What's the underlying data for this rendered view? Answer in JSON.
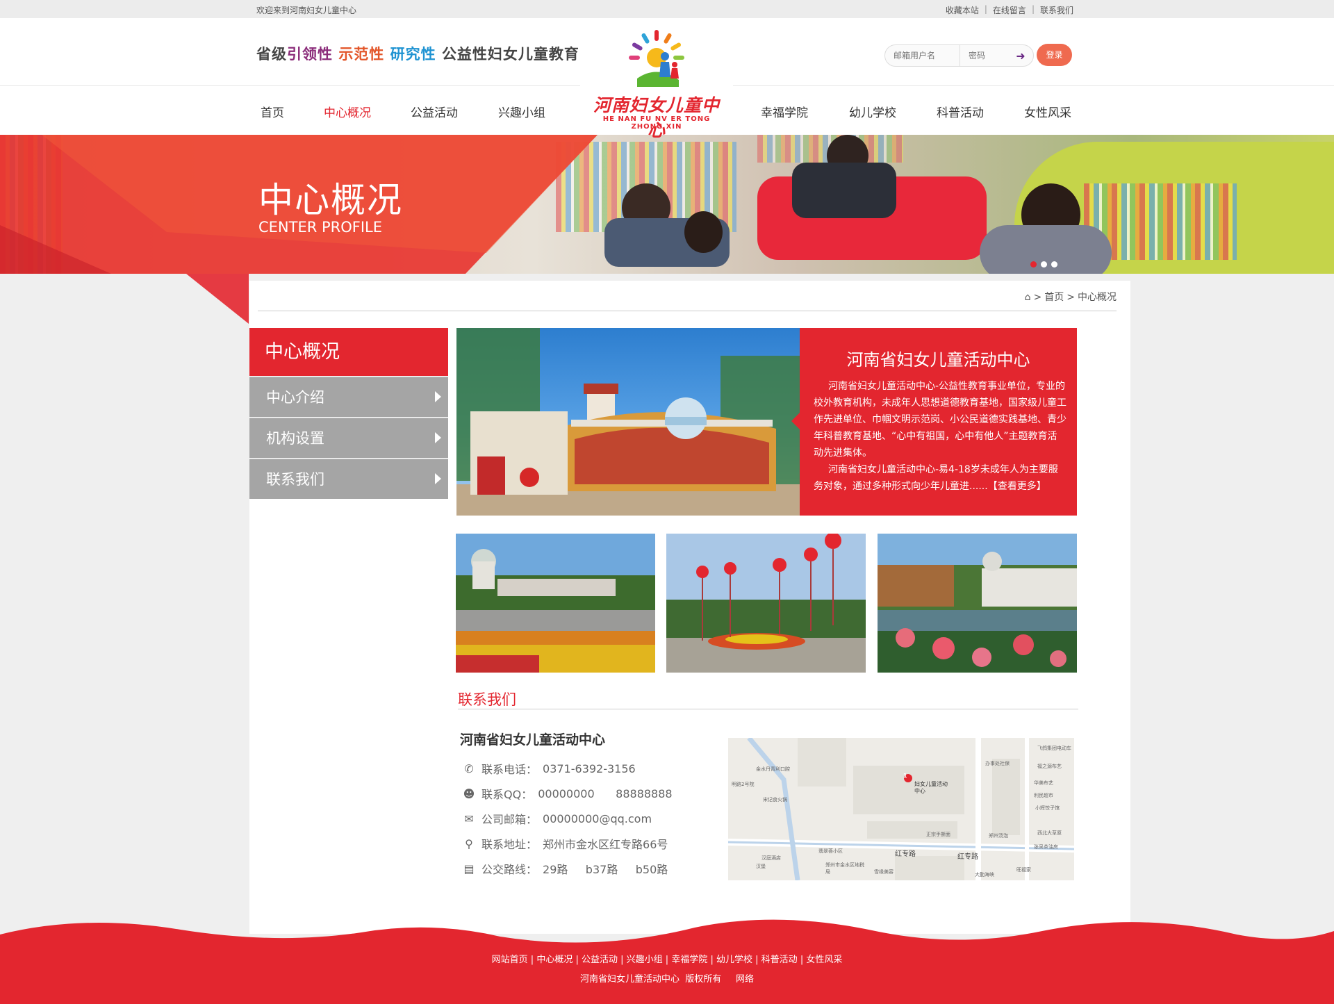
{
  "topbar": {
    "welcome": "欢迎来到河南妇女儿童中心",
    "links": [
      "收藏本站",
      "在线留言",
      "联系我们"
    ]
  },
  "header": {
    "slogan": {
      "p1": "省级",
      "p2": "引领性",
      "p3": "示范性",
      "p4": "研究性",
      "p5": "公益性妇女儿童教育阵地"
    },
    "login": {
      "user_placeholder": "邮箱用户名",
      "pwd_placeholder": "密码",
      "submit_label": "登录",
      "go_icon": "arrow-right-icon"
    },
    "logo": {
      "cn": "河南妇女儿童中心",
      "en": "HE NAN FU NV ER TONG  ZHONG XIN"
    }
  },
  "nav": {
    "items": [
      "首页",
      "中心概况",
      "公益活动",
      "兴趣小组",
      "幸福学院",
      "幼儿学校",
      "科普活动",
      "女性风采"
    ],
    "active": "中心概况"
  },
  "banner": {
    "title_cn": "中心概况",
    "title_en": "CENTER PROFILE"
  },
  "breadcrumb": {
    "home_icon": "home-icon",
    "sep": ">",
    "home": "首页",
    "current": "中心概况"
  },
  "sidebar": {
    "heading": "中心概况",
    "items": [
      "中心介绍",
      "机构设置",
      "联系我们"
    ]
  },
  "intro": {
    "title": "河南省妇女儿童活动中心",
    "para1": "河南省妇女儿童活动中心-公益性教育事业单位，专业的校外教育机构，未成年人思想道德教育基地，国家级儿童工作先进单位、巾帼文明示范岗、小公民道德实践基地、青少年科普教育基地、“心中有祖国，心中有他人”主题教育活动先进集体。",
    "para2": "河南省妇女儿童活动中心-易4-18岁未成年人为主要服务对象，通过多种形式向少年儿童进......",
    "more": "【查看更多】"
  },
  "contact": {
    "title": "联系我们",
    "org": "河南省妇女儿童活动中心",
    "rows": [
      {
        "icon": "phone-icon",
        "label": "联系电话：",
        "value": "0371-6392-3156"
      },
      {
        "icon": "qq-icon",
        "label": "联系QQ：",
        "value": "00000000      88888888"
      },
      {
        "icon": "mail-icon",
        "label": "公司邮箱：",
        "value": "00000000@qq.com"
      },
      {
        "icon": "location-icon",
        "label": "联系地址：",
        "value": "郑州市金水区红专路66号"
      },
      {
        "icon": "bus-icon",
        "label": "公交路线：",
        "value": "29路     b37路     b50路"
      }
    ],
    "map": {
      "marker_label": "妇女儿童活动中心",
      "roads": [
        "红专路",
        "红专路"
      ],
      "pois": [
        "金水丹青利口腔",
        "飞鸽集团电动车",
        "办事处社保",
        "福之源布艺",
        "明路2号院",
        "宋记食火锅",
        "小辉饺子馆",
        "正宗手撕面",
        "郑州汤泡",
        "西北大草原",
        "张吴茶油房",
        "汉庭酒店",
        "翡翠荟小区",
        "郑州市金水区地税局",
        "雪缘美容",
        "大勤海峡",
        "汉堡",
        "旺福家",
        "华美布艺",
        "利民超市"
      ]
    }
  },
  "footer": {
    "links": [
      "网站首页",
      "中心概况",
      "公益活动",
      "兴趣小组",
      "幸福学院",
      "幼儿学校",
      "科普活动",
      "女性风采"
    ],
    "copyright": "河南省妇女儿童活动中心  版权所有     网络"
  },
  "colors": {
    "brand_red": "#e3262f",
    "sidebar_grey": "#a5a5a5",
    "login_btn": "#ef6a4f"
  }
}
